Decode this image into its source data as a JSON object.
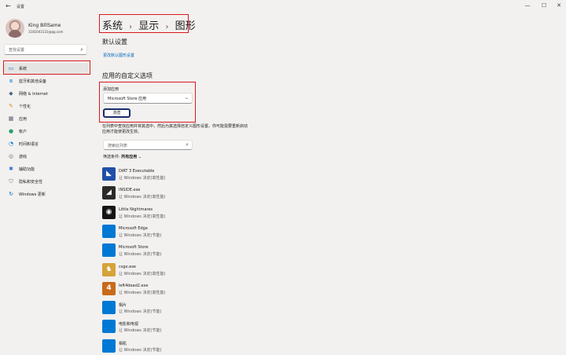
{
  "window": {
    "title": "设置"
  },
  "user": {
    "name": "King BillSame",
    "email": "1181043131@qq.com"
  },
  "sidebar": {
    "search_placeholder": "查找设置",
    "items": [
      {
        "label": "系统",
        "icon": "system-icon",
        "color": "#0067c0"
      },
      {
        "label": "蓝牙和其他设备",
        "icon": "bluetooth-icon",
        "color": "#0078d4"
      },
      {
        "label": "网络 & Internet",
        "icon": "network-icon",
        "color": "#4a6b8a"
      },
      {
        "label": "个性化",
        "icon": "brush-icon",
        "color": "#e0883a"
      },
      {
        "label": "应用",
        "icon": "apps-icon",
        "color": "#5a5a7a"
      },
      {
        "label": "帐户",
        "icon": "account-icon",
        "color": "#2aa06b"
      },
      {
        "label": "时间和语言",
        "icon": "time-language-icon",
        "color": "#0078d4"
      },
      {
        "label": "游戏",
        "icon": "gaming-icon",
        "color": "#6a6a6a"
      },
      {
        "label": "辅助功能",
        "icon": "accessibility-icon",
        "color": "#2d6bd1"
      },
      {
        "label": "隐私和安全性",
        "icon": "shield-icon",
        "color": "#707070"
      },
      {
        "label": "Windows 更新",
        "icon": "update-icon",
        "color": "#0067c0"
      }
    ]
  },
  "breadcrumb": [
    "系统",
    "显示",
    "图形"
  ],
  "defaults": {
    "title": "默认设置",
    "link": "更改默认图形设置"
  },
  "custom": {
    "title": "应用的自定义选项",
    "add_label": "添加应用",
    "select_value": "Microsoft Store 应用",
    "browse_label": "浏览",
    "info": "在列表中查找应用并将其选中，然后为其选择自定义图形设置。你可能需要重新启动应用才能使更改生效。"
  },
  "list": {
    "search_placeholder": "搜索此列表",
    "filter_label": "筛选条件:",
    "filter_value": "所有应用",
    "apps": [
      {
        "name": "DiRT 3 Executable",
        "pref": "让 Windows 决定(高性能)",
        "icon": "dirt3-icon",
        "color": "#1f4fa8",
        "glyph": "◣"
      },
      {
        "name": "INSIDE.exe",
        "pref": "让 Windows 决定(高性能)",
        "icon": "inside-icon",
        "color": "#2a2a2a",
        "glyph": "◢"
      },
      {
        "name": "Little Nightmares",
        "pref": "让 Windows 决定(高性能)",
        "icon": "little-nightmares-icon",
        "color": "#141414",
        "glyph": "◉"
      },
      {
        "name": "Microsoft Edge",
        "pref": "让 Windows 决定(节能)",
        "icon": "edge-icon",
        "color": "#0078d4",
        "glyph": ""
      },
      {
        "name": "Microsoft Store",
        "pref": "让 Windows 决定(节能)",
        "icon": "store-icon",
        "color": "#0078d4",
        "glyph": ""
      },
      {
        "name": "csgo.exe",
        "pref": "让 Windows 决定(高性能)",
        "icon": "csgo-icon",
        "color": "#d6a23a",
        "glyph": "♞"
      },
      {
        "name": "left4dead2.exe",
        "pref": "让 Windows 决定(高性能)",
        "icon": "left4dead2-icon",
        "color": "#c96a1a",
        "glyph": "4"
      },
      {
        "name": "相片",
        "pref": "让 Windows 决定(节能)",
        "icon": "photos-icon",
        "color": "#0078d4",
        "glyph": ""
      },
      {
        "name": "电影和电视",
        "pref": "让 Windows 决定(节能)",
        "icon": "movies-tv-icon",
        "color": "#0078d4",
        "glyph": ""
      },
      {
        "name": "相机",
        "pref": "让 Windows 决定(节能)",
        "icon": "camera-icon",
        "color": "#0078d4",
        "glyph": ""
      }
    ]
  }
}
